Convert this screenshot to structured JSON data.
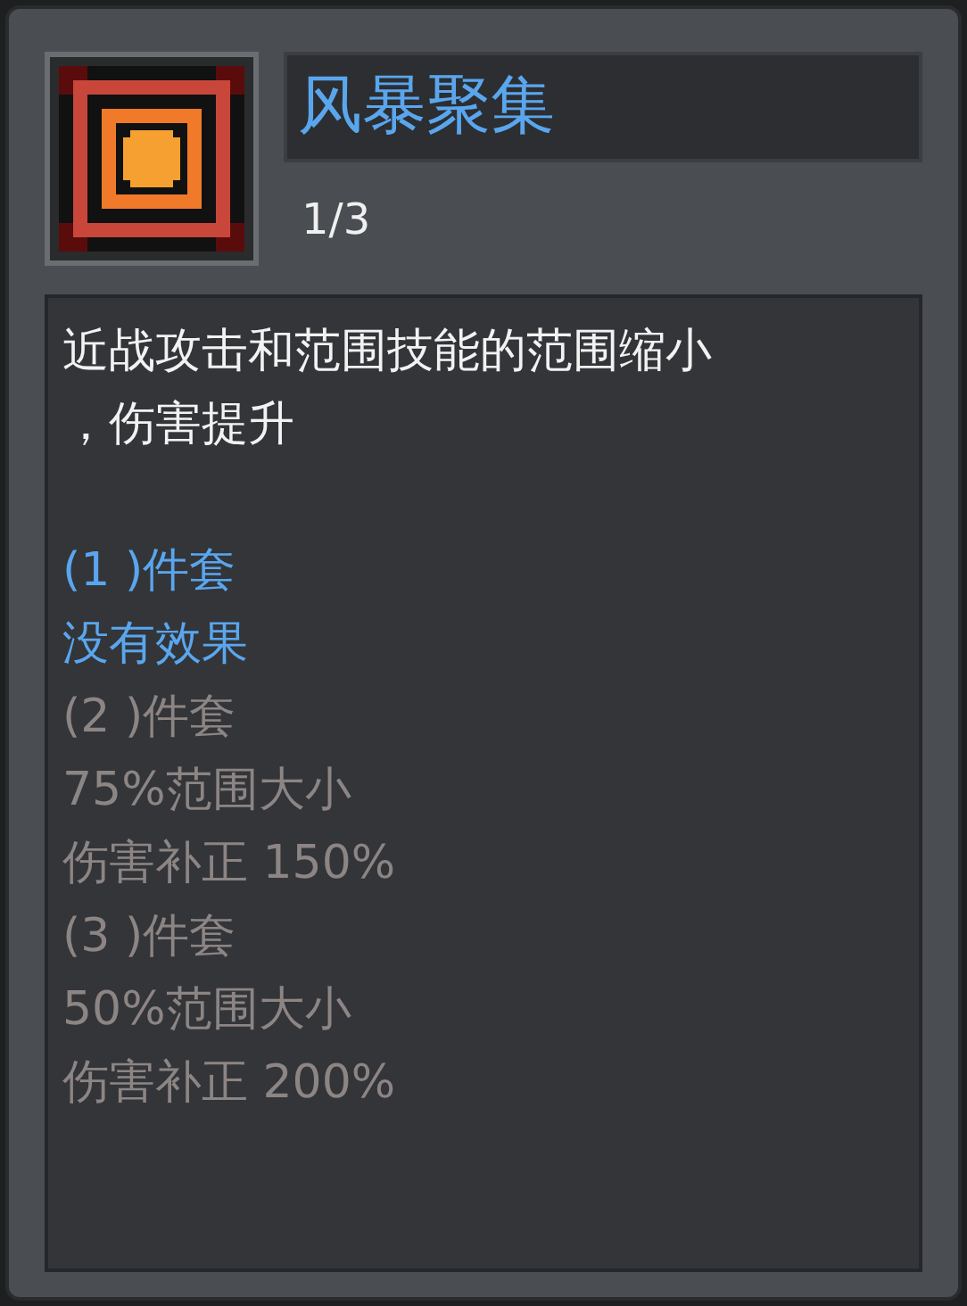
{
  "item": {
    "name": "风暴聚集",
    "count": "1/3"
  },
  "description": [
    "近战攻击和范围技能的范围缩小",
    "，伤害提升"
  ],
  "set_bonuses": [
    {
      "heading": "(1 )件套",
      "active": true,
      "effects": [
        "没有效果"
      ]
    },
    {
      "heading": "(2 )件套",
      "active": false,
      "effects": [
        "75%范围大小",
        "伤害补正 150%"
      ]
    },
    {
      "heading": "(3 )件套",
      "active": false,
      "effects": [
        "50%范围大小",
        "伤害补正 200%"
      ]
    }
  ]
}
